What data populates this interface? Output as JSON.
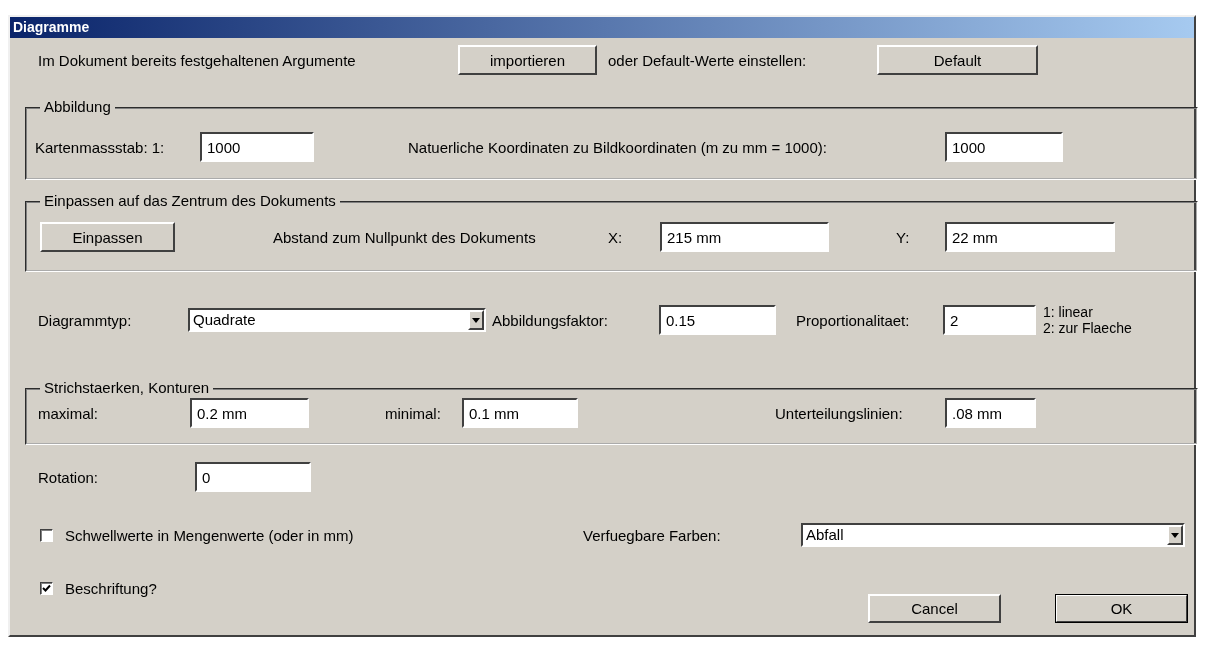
{
  "window": {
    "title": "Diagramme"
  },
  "import_row": {
    "label": "Im Dokument bereits festgehaltenen Argumente",
    "import_button": "importieren",
    "default_label": "oder Default-Werte einstellen:",
    "default_button": "Default"
  },
  "abbildung": {
    "legend": "Abbildung",
    "scale_label": "Kartenmassstab: 1:",
    "scale_value": "1000",
    "coords_label": "Natuerliche Koordinaten zu Bildkoordinaten (m zu mm = 1000):",
    "coords_value": "1000"
  },
  "einpassen": {
    "legend": "Einpassen auf das Zentrum des Dokuments",
    "button": "Einpassen",
    "distance_label": "Abstand zum Nullpunkt des Dokuments",
    "x_label": "X:",
    "x_value": "215 mm",
    "y_label": "Y:",
    "y_value": "22 mm"
  },
  "diagram": {
    "type_label": "Diagrammtyp:",
    "type_value": "Quadrate",
    "factor_label": "Abbildungsfaktor:",
    "factor_value": "0.15",
    "prop_label": "Proportionalitaet:",
    "prop_value": "2",
    "prop_notes": [
      "1: linear",
      "2: zur Flaeche"
    ]
  },
  "strokes": {
    "legend": "Strichstaerken, Konturen",
    "max_label": "maximal:",
    "max_value": "0.2 mm",
    "min_label": "minimal:",
    "min_value": "0.1 mm",
    "sub_label": "Unterteilungslinien:",
    "sub_value": ".08 mm"
  },
  "rotation": {
    "label": "Rotation:",
    "value": "0"
  },
  "options": [
    {
      "label": "Schwellwerte in Mengenwerte (oder in mm)",
      "checked": false
    },
    {
      "label": "Beschriftung?",
      "checked": true
    }
  ],
  "colors": {
    "label": "Verfuegbare Farben:",
    "value": "Abfall"
  },
  "buttons": [
    "Cancel",
    "OK"
  ]
}
